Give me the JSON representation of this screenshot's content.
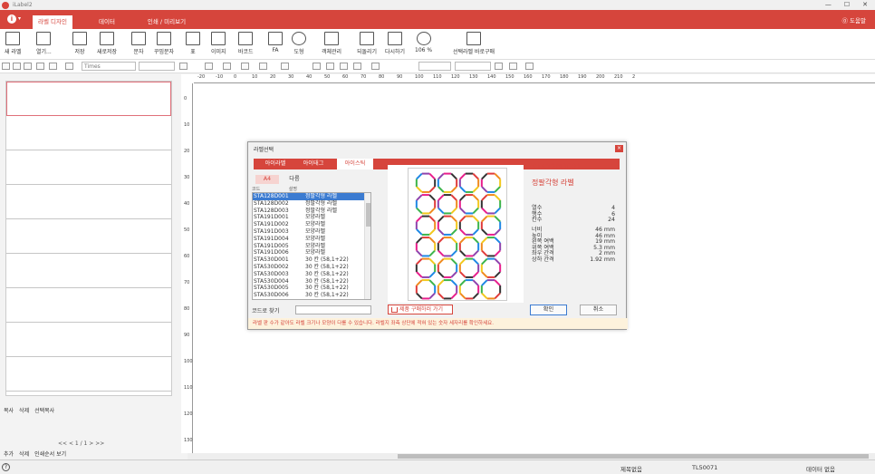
{
  "app": {
    "title": "iLabel2",
    "minimize": "—",
    "restore": "☐",
    "close": "✕"
  },
  "ribbon": {
    "tabs": [
      {
        "label": "라벨 디자인",
        "active": true
      },
      {
        "label": "데이터",
        "active": false
      },
      {
        "label": "인쇄 / 미리보기",
        "active": false
      }
    ],
    "help": "⓪ 도움말"
  },
  "toolbar": {
    "buttons": [
      {
        "label": "새 라벨",
        "icon": "new-label-icon"
      },
      {
        "label": "열기...",
        "icon": "open-icon"
      },
      {
        "label": "저장",
        "icon": "save-icon"
      },
      {
        "label": "새로저장",
        "icon": "save-as-icon"
      },
      {
        "label": "문자",
        "icon": "text-icon"
      },
      {
        "label": "꾸밈문자",
        "icon": "styled-text-icon"
      },
      {
        "label": "표",
        "icon": "table-icon"
      },
      {
        "label": "이미지",
        "icon": "image-icon"
      },
      {
        "label": "바코드",
        "icon": "barcode-icon"
      },
      {
        "label": "FA",
        "icon": "fa-icon"
      },
      {
        "label": "도형",
        "icon": "shape-icon"
      },
      {
        "label": "객체관리",
        "icon": "object-manage-icon"
      },
      {
        "label": "되돌리기",
        "icon": "undo-icon"
      },
      {
        "label": "다시하기",
        "icon": "redo-icon"
      },
      {
        "label": "106 %",
        "icon": "zoom-icon"
      },
      {
        "label": "선택라벨 바로구매",
        "icon": "cart-icon"
      }
    ]
  },
  "format": {
    "font": "Times"
  },
  "ruler": {
    "h": [
      "-20",
      "-10",
      "0",
      "10",
      "20",
      "30",
      "40",
      "50",
      "60",
      "70",
      "80",
      "90",
      "100",
      "110",
      "120",
      "130",
      "140",
      "150",
      "160",
      "170",
      "180",
      "190",
      "200",
      "210",
      "2"
    ],
    "v": [
      "0",
      "10",
      "20",
      "30",
      "40",
      "50",
      "60",
      "70",
      "80",
      "90",
      "100",
      "110",
      "120",
      "130"
    ]
  },
  "left_panel": {
    "copy": "복사",
    "delete": "삭제",
    "select_copy": "선택복사",
    "pager": "<<   <    1 / 1    >   >>",
    "add": "추가",
    "delete2": "삭제",
    "print_order": "인쇄순서 보기"
  },
  "dialog": {
    "title": "라벨선택",
    "close": "×",
    "tabs": [
      {
        "label": "아이라벨",
        "active": false
      },
      {
        "label": "아이태그",
        "active": false
      },
      {
        "label": "아이스틱",
        "active": true
      }
    ],
    "sizes": [
      {
        "label": "A4",
        "active": true
      },
      {
        "label": "다름",
        "active": false
      }
    ],
    "list_header": {
      "code": "코드",
      "desc": "설명"
    },
    "rows": [
      {
        "code": "STA128D001",
        "desc": "정팔각형 라벨",
        "selected": true
      },
      {
        "code": "STA128D002",
        "desc": "정팔각형 라벨",
        "selected": false
      },
      {
        "code": "STA128D003",
        "desc": "정팔각형 라벨",
        "selected": false
      },
      {
        "code": "STA191D001",
        "desc": "모양라벨",
        "selected": false
      },
      {
        "code": "STA191D002",
        "desc": "모양라벨",
        "selected": false
      },
      {
        "code": "STA191D003",
        "desc": "모양라벨",
        "selected": false
      },
      {
        "code": "STA191D004",
        "desc": "모양라벨",
        "selected": false
      },
      {
        "code": "STA191D005",
        "desc": "모양라벨",
        "selected": false
      },
      {
        "code": "STA191D006",
        "desc": "모양라벨",
        "selected": false
      },
      {
        "code": "STA530D001",
        "desc": "30 칸 (58,1+22)",
        "selected": false
      },
      {
        "code": "STA530D002",
        "desc": "30 칸 (58,1+22)",
        "selected": false
      },
      {
        "code": "STA530D003",
        "desc": "30 칸 (58,1+22)",
        "selected": false
      },
      {
        "code": "STA530D004",
        "desc": "30 칸 (58,1+22)",
        "selected": false
      },
      {
        "code": "STA530D005",
        "desc": "30 칸 (58,1+22)",
        "selected": false
      },
      {
        "code": "STA530D006",
        "desc": "30 칸 (58,1+22)",
        "selected": false
      }
    ],
    "code_search_label": "코드로 찾기",
    "code_search_value": "",
    "buy_link": "제품 구매하러 가기",
    "info_code": "STA128D001",
    "info_name": "정팔각형 라벨",
    "counts": [
      {
        "k": "열수",
        "v": "4"
      },
      {
        "k": "행수",
        "v": "6"
      },
      {
        "k": "칸수",
        "v": "24"
      }
    ],
    "dims": [
      {
        "k": "너비",
        "v": "46 mm"
      },
      {
        "k": "높이",
        "v": "46 mm"
      },
      {
        "k": "왼쪽 여백",
        "v": "19 mm"
      },
      {
        "k": "위쪽 여백",
        "v": "5.3 mm"
      },
      {
        "k": "좌우 간격",
        "v": "2 mm"
      },
      {
        "k": "상하 간격",
        "v": "1.92 mm"
      }
    ],
    "ok": "확인",
    "cancel": "취소",
    "note": "라벨 판 수가 같아도 라벨 크기나 모양이 다를 수 있습니다. 라벨지 좌측 상단에 적혀 있는 숫자 세자리를 확인하세요.",
    "octagon_colors": [
      "#e03b3b",
      "#f08a1e",
      "#f2c81e",
      "#3cb44b",
      "#1e88e5",
      "#8e44ad",
      "#e91e8c",
      "#333333"
    ]
  },
  "status": {
    "help": "?",
    "doc": "제목없음",
    "label_code": "TL50071",
    "data": "데이터 없음"
  }
}
